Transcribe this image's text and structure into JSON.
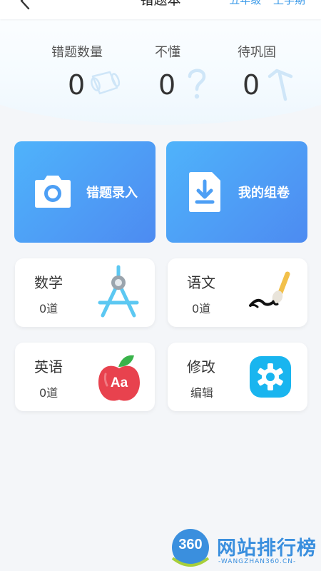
{
  "header": {
    "title": "错题本",
    "grade": "五年级",
    "term": "上学期",
    "accent_color": "#3d9be9"
  },
  "stats": [
    {
      "label": "错题数量",
      "value": "0",
      "icon": "scroll-icon"
    },
    {
      "label": "不懂",
      "value": "0",
      "icon": "question-icon"
    },
    {
      "label": "待巩固",
      "value": "0",
      "icon": "hammer-icon"
    }
  ],
  "actions": {
    "record": {
      "label": "错题录入",
      "icon": "camera-icon"
    },
    "paper": {
      "label": "我的组卷",
      "icon": "download-doc-icon"
    }
  },
  "subjects": [
    {
      "name": "数学",
      "count": "0道",
      "icon": "compass-icon"
    },
    {
      "name": "语文",
      "count": "0道",
      "icon": "brush-icon"
    },
    {
      "name": "英语",
      "count": "0道",
      "icon": "apple-icon",
      "icon_text": "Aa"
    },
    {
      "name": "修改",
      "count": "编辑",
      "icon": "gear-icon"
    }
  ],
  "watermark": {
    "logo_text": "360",
    "title": "网站排行榜",
    "subtitle": "-WANGZHAN360.CN-"
  }
}
